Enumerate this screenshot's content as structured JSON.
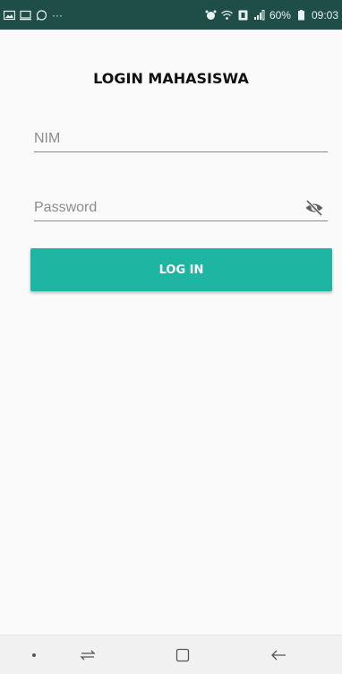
{
  "status_bar": {
    "left_icons": [
      "gallery-icon",
      "cast-icon",
      "whatsapp-icon",
      "more-dots-icon"
    ],
    "more": "···",
    "right_icons": [
      "alarm-icon",
      "wifi-icon",
      "sim-icon",
      "signal-icon"
    ],
    "battery": "60%",
    "time": "09:03"
  },
  "login": {
    "title": "LOGIN MAHASISWA",
    "nim_placeholder": "NIM",
    "nim_value": "",
    "password_placeholder": "Password",
    "password_value": "",
    "password_toggle_icon": "eye-off-icon",
    "button_label": "LOG IN"
  },
  "nav_bar": {
    "items": [
      "dot-icon",
      "recents-icon",
      "home-icon",
      "back-icon"
    ]
  },
  "colors": {
    "status_bar": "#1f4d47",
    "accent": "#1fb5a3",
    "background": "#fafafa"
  }
}
